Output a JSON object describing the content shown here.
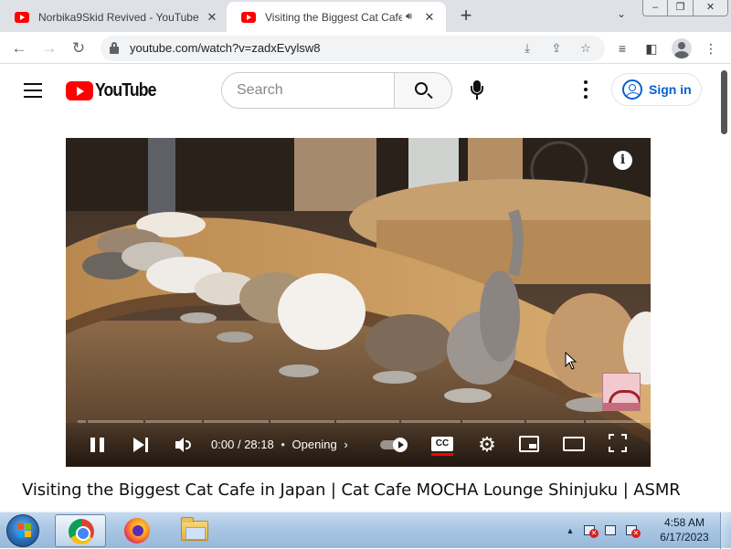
{
  "browser": {
    "tabs": [
      {
        "title": "Norbika9Skid Revived - YouTube",
        "active": false
      },
      {
        "title": "Visiting the Biggest Cat Cafe",
        "active": true
      }
    ],
    "new_tab_icon": "+",
    "url": "youtube.com/watch?v=zadxEvylsw8"
  },
  "youtube": {
    "logo_text": "YouTube",
    "search_placeholder": "Search",
    "sign_in_label": "Sign in",
    "player": {
      "time_current": "0:00",
      "time_total": "28:18",
      "chapter": "Opening",
      "cc_label": "CC",
      "info_label": "i",
      "progress_fraction": 0.002
    },
    "video_title": "Visiting the Biggest Cat Cafe in Japan | Cat Cafe MOCHA Lounge Shinjuku | ASMR"
  },
  "taskbar": {
    "apps": [
      "chrome",
      "firefox",
      "windows-explorer"
    ],
    "clock_time": "4:58 AM",
    "clock_date": "6/17/2023"
  },
  "colors": {
    "youtube_red": "#ff0000",
    "link_blue": "#065fd4",
    "tab_strip": "#dee1e6"
  }
}
